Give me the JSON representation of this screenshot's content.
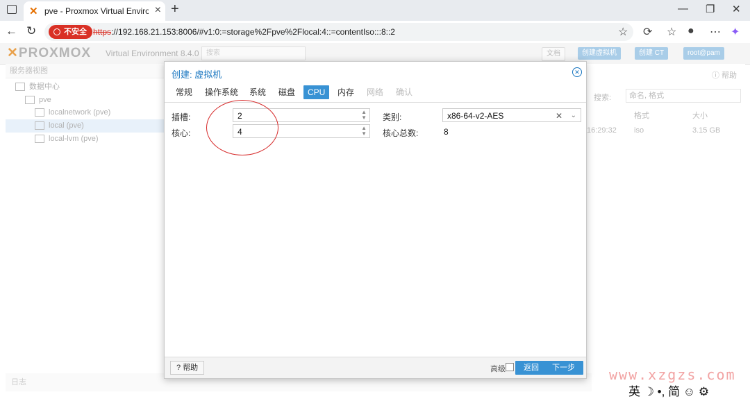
{
  "browser": {
    "tab_title": "pve - Proxmox Virtual Environment",
    "new_tab": "+",
    "url_security_badge": "不安全",
    "url_protocol": "https",
    "url_rest": "://192.168.21.153:8006/#v1:0:=storage%2Fpve%2Flocal:4::=contentIso:::8::2",
    "window_controls": [
      "—",
      "❐",
      "✕"
    ]
  },
  "pve_header": {
    "logo": "PROXMOX",
    "version": "Virtual Environment 8.4.0",
    "search_placeholder": "搜索",
    "docs_button": "文档",
    "create_vm_button": "创建虚拟机",
    "create_ct_button": "创建 CT",
    "user_button": "root@pam"
  },
  "left_tree": {
    "header": "服务器视图",
    "items": [
      "数据中心",
      "pve",
      "localnetwork (pve)",
      "local (pve)",
      "local-lvm (pve)"
    ]
  },
  "right_bg": {
    "help": "帮助",
    "search_label": "搜索:",
    "search_placeholder": "命名, 格式",
    "col_format": "格式",
    "col_size": "大小",
    "row_time": "16:29:32",
    "row_format": "iso",
    "row_size": "3.15 GB"
  },
  "status_bar": "日志",
  "modal": {
    "title": "创建: 虚拟机",
    "tabs": [
      "常规",
      "操作系统",
      "系统",
      "磁盘",
      "CPU",
      "内存",
      "网络",
      "确认"
    ],
    "active_tab": "CPU",
    "fields": {
      "sockets_label": "插槽:",
      "sockets_value": "2",
      "cores_label": "核心:",
      "cores_value": "4",
      "type_label": "类别:",
      "type_value": "x86-64-v2-AES",
      "total_cores_label": "核心总数:",
      "total_cores_value": "8"
    },
    "footer": {
      "help": "帮助",
      "advanced": "高级",
      "back": "返回",
      "next": "下一步"
    }
  },
  "watermark": "www.xzgzs.com",
  "ime_bar": "英 ☽ •, 简 ☺ ⚙"
}
